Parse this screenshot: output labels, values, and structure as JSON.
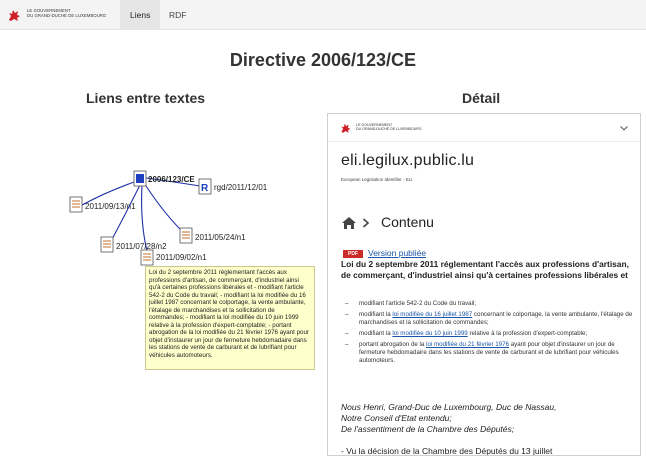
{
  "header": {
    "logo_line1": "LE GOUVERNEMENT",
    "logo_line2": "DU GRAND-DUCHÉ DE LUXEMBOURG",
    "tabs": [
      {
        "label": "Liens",
        "active": true
      },
      {
        "label": "RDF",
        "active": false
      }
    ]
  },
  "page_title": "Directive 2006/123/CE",
  "links_section": {
    "title": "Liens entre textes",
    "nodes": {
      "center": "2006/123/CE",
      "rgd": "rgd/2011/12/01",
      "n1": "2011/09/13/n1",
      "n2": "2011/07/28/n2",
      "n3": "2011/05/24/n1",
      "n4": "2011/09/02/n1"
    },
    "tooltip": "Loi du 2 septembre 2011 réglementant l'accès aux professions d'artisan, de commerçant, d'industriel ainsi qu'à certaines professions libérales et - modifiant l'article 542-2 du Code du travail; - modifiant la loi modifiée du 16 juillet 1987 concernant le colportage, la vente ambulante, l'étalage de marchandises et la sollicitation de commandes; - modifiant la loi modifiée du 10 juin 1999 relative à la profession d'expert-comptable; - portant abrogation de la loi modifiée du 21 février 1976 ayant pour objet d'instaurer un jour de fermeture hebdomadaire dans les stations de vente de carburant et de lubrifiant pour véhicules automoteurs."
  },
  "detail_section": {
    "title": "Détail",
    "logo_line1": "LE GOUVERNEMENT",
    "logo_line2": "DU GRAND-DUCHÉ DE LUXEMBOURG",
    "site_name": "eli.legilux.public.lu",
    "site_sub": "European Legislation Identifier - ELI",
    "breadcrumb_label": "Contenu",
    "pdf_badge": "PDF",
    "version_link": "Version publiée",
    "law_title": "Loi du 2 septembre 2011 réglementant l'accès aux professions d'artisan, de commerçant, d'industriel ainsi qu'à certaines professions libérales et",
    "items": {
      "i1": "modifiant l'article 542-2 du Code du travail;",
      "i2_pre": "modifiant la ",
      "i2_link": "loi modifiée du 16 juillet 1987",
      "i2_post": " concernant le colportage, la vente ambulante, l'étalage de marchandises et la sollicitation de commandes;",
      "i3_pre": "modifiant la ",
      "i3_link": "loi modifiée du 10 juin 1999",
      "i3_post": " relative à la profession d'expert-comptable;",
      "i4_pre": "portant abrogation de la ",
      "i4_link": "loi modifiée du 21 février 1976",
      "i4_post": " ayant pour objet d'instaurer un jour de fermeture hebdomadaire dans les stations de vente de carburant et de lubrifiant pour véhicules automoteurs."
    },
    "preamble_1": "Nous Henri, Grand-Duc de Luxembourg, Duc de Nassau,",
    "preamble_2": "Notre Conseil d'Etat entendu;",
    "preamble_3": "De l'assentiment de la Chambre des Députés;",
    "last_line": "- Vu la décision de la Chambre des Députés du 13 juillet"
  },
  "colors": {
    "edge": "#1f2fa8",
    "lion_red": "#d0202a",
    "link": "#1a55a6",
    "tooltip_bg": "#ffffcc"
  }
}
